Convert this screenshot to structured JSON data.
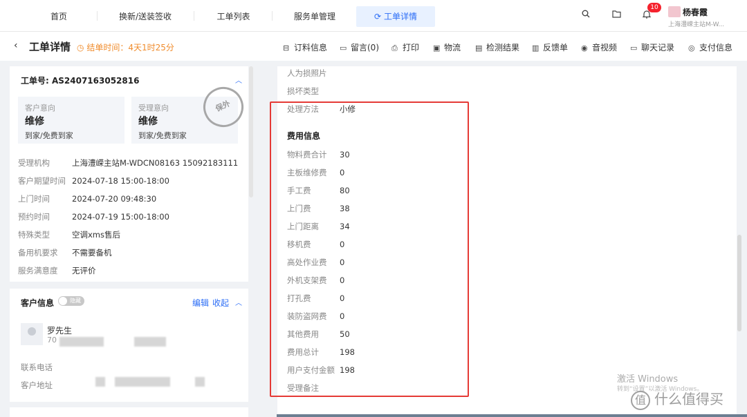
{
  "nav": {
    "tabs": [
      "首页",
      "换新/送装签收",
      "工单列表",
      "服务单管理",
      "工单详情"
    ],
    "active_tab_icon": "refresh-icon",
    "notification_count": "10",
    "user_name": "杨春霞",
    "user_org": "上海澧嵘主站M-W..."
  },
  "header": {
    "back": "‹",
    "title": "工单详情",
    "deadline": "结单时间：4天1时25分",
    "actions": [
      {
        "label": "订料信息",
        "icon": "package-icon"
      },
      {
        "label": "留言(0)",
        "icon": "message-icon"
      },
      {
        "label": "打印",
        "icon": "printer-icon"
      },
      {
        "label": "物流",
        "icon": "truck-icon"
      },
      {
        "label": "检测结果",
        "icon": "document-icon"
      },
      {
        "label": "反馈单",
        "icon": "feedback-icon"
      },
      {
        "label": "音视频",
        "icon": "play-icon"
      },
      {
        "label": "聊天记录",
        "icon": "chat-icon"
      },
      {
        "label": "支付信息",
        "icon": "payment-icon"
      }
    ]
  },
  "order": {
    "number": "工单号: AS2407163052816",
    "customer_intent": {
      "label": "客户意向",
      "type": "维修",
      "mode": "到家/免费到家"
    },
    "accept_intent": {
      "label": "受理意向",
      "type": "维修",
      "mode": "到家/免费到家"
    },
    "stamp": "保外",
    "fields": [
      {
        "k": "受理机构",
        "v": "上海澧嵘主站M-WDCN08163 15092183111"
      },
      {
        "k": "客户期望时间",
        "v": "2024-07-18 15:00-18:00"
      },
      {
        "k": "上门时间",
        "v": "2024-07-20 09:48:30"
      },
      {
        "k": "预约时间",
        "v": "2024-07-19 15:00-18:00"
      },
      {
        "k": "特殊类型",
        "v": "空调xms售后"
      },
      {
        "k": "备用机要求",
        "v": "不需要备机"
      },
      {
        "k": "服务满意度",
        "v": "无评价"
      }
    ]
  },
  "customer": {
    "title": "客户信息",
    "toggle": "隐藏",
    "edit": "编辑",
    "collapse": "收起",
    "name": "罗先生",
    "id_prefix": "70",
    "phone_label": "联系电话",
    "address_label": "客户地址"
  },
  "details": {
    "top_rows": [
      {
        "k": "人为损照片",
        "v": ""
      },
      {
        "k": "损坏类型",
        "v": ""
      },
      {
        "k": "处理方法",
        "v": "小修"
      }
    ],
    "fee_title": "费用信息",
    "fees": [
      {
        "k": "物料费合计",
        "v": "30"
      },
      {
        "k": "主板维修费",
        "v": "0"
      },
      {
        "k": "手工费",
        "v": "80"
      },
      {
        "k": "上门费",
        "v": "38"
      },
      {
        "k": "上门距离",
        "v": "34"
      },
      {
        "k": "移机费",
        "v": "0"
      },
      {
        "k": "高处作业费",
        "v": "0"
      },
      {
        "k": "外机支架费",
        "v": "0"
      },
      {
        "k": "打孔费",
        "v": "0"
      },
      {
        "k": "装防盗网费",
        "v": "0"
      },
      {
        "k": "其他费用",
        "v": "50"
      },
      {
        "k": "费用总计",
        "v": "198"
      },
      {
        "k": "用户支付金额",
        "v": "198"
      },
      {
        "k": "受理备注",
        "v": ""
      }
    ]
  },
  "watermark": {
    "line1": "激活 Windows",
    "line2": "转到“设置”以激活 Windows。",
    "brand": "什么值得买",
    "brand_mark": "值"
  }
}
